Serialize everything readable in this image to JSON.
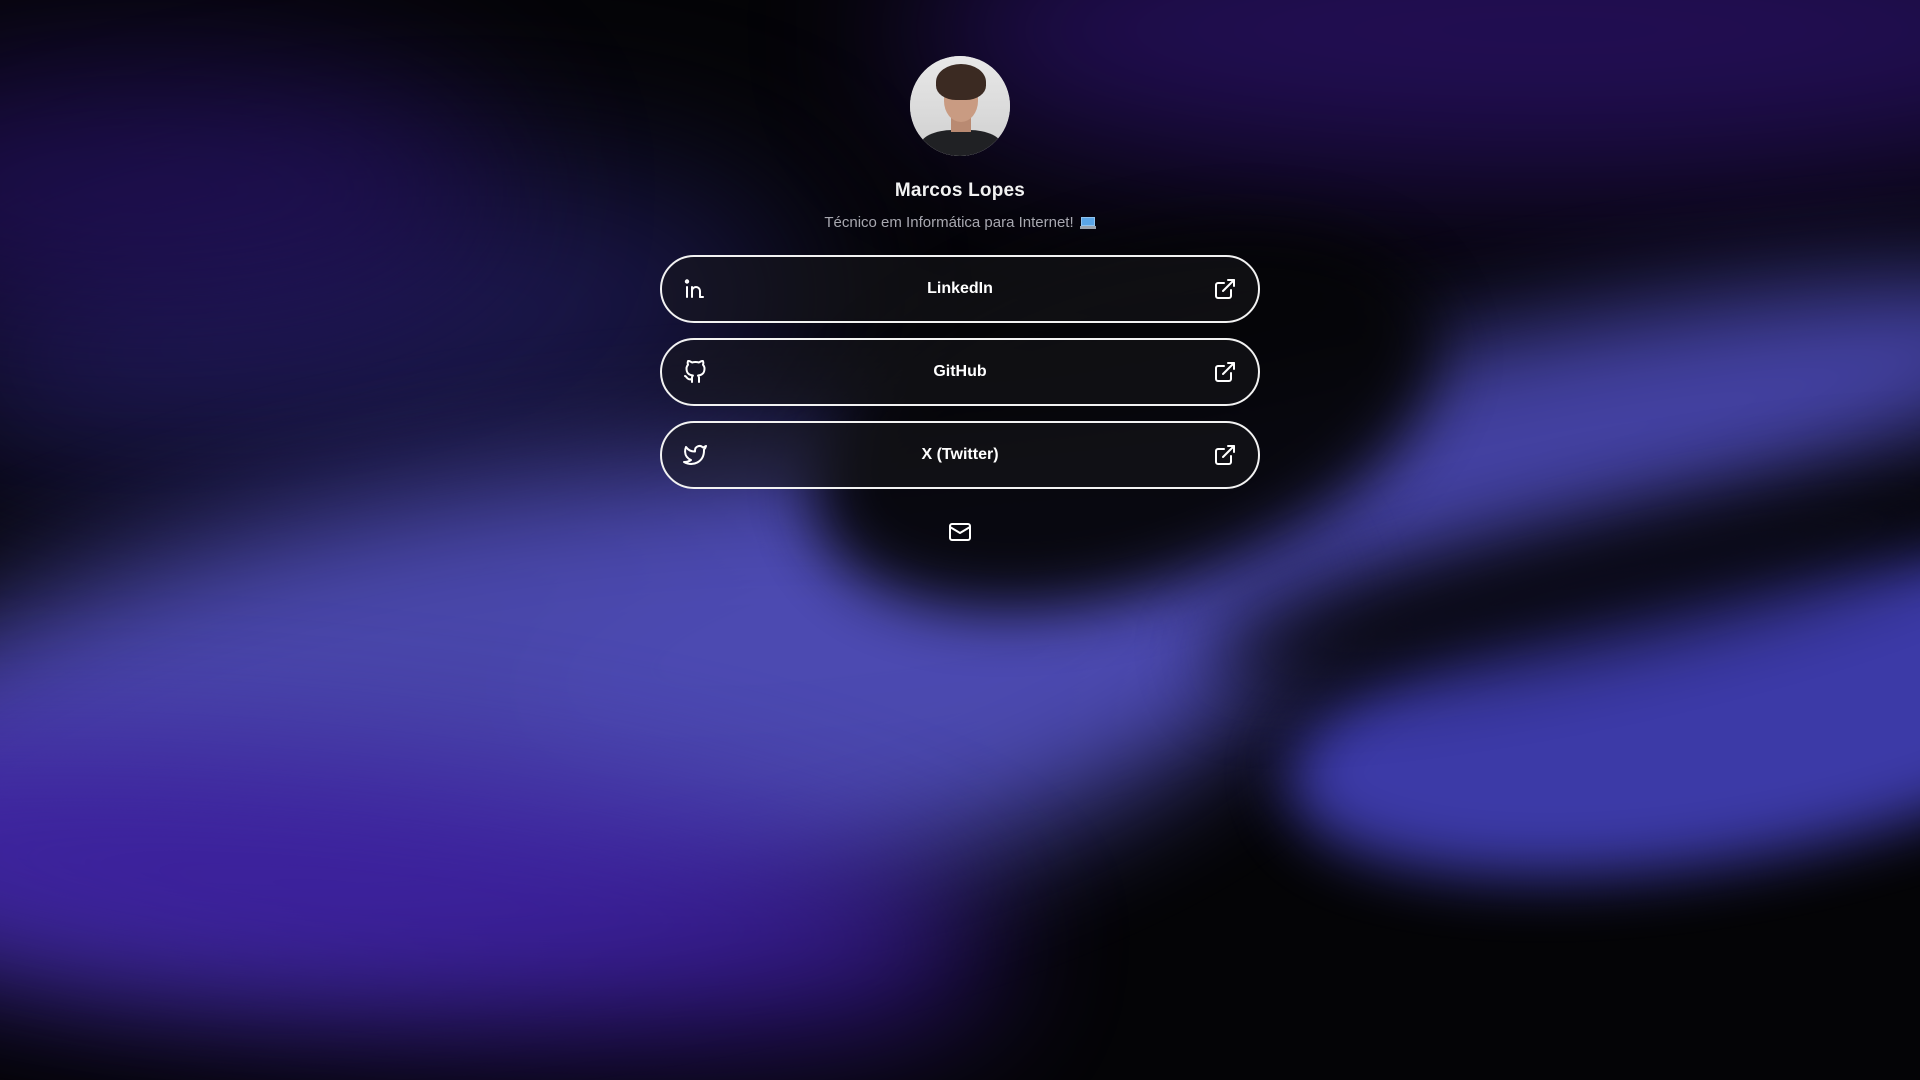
{
  "profile": {
    "name": "Marcos Lopes",
    "subtitle": "Técnico em Informática para Internet!",
    "subtitle_emoji": "laptop-emoji"
  },
  "links": [
    {
      "label": "LinkedIn",
      "icon": "linkedin-icon",
      "action_icon": "external-link-icon"
    },
    {
      "label": "GitHub",
      "icon": "github-icon",
      "action_icon": "external-link-icon"
    },
    {
      "label": "X (Twitter)",
      "icon": "twitter-icon",
      "action_icon": "external-link-icon"
    }
  ],
  "contact": {
    "icon": "mail-icon"
  },
  "colors": {
    "background": "#050507",
    "accent_blue": "#4d4bb3",
    "accent_purple": "#3a1a9a",
    "button_border": "#f2f2f2",
    "subtitle_text": "#a8a8b0"
  }
}
